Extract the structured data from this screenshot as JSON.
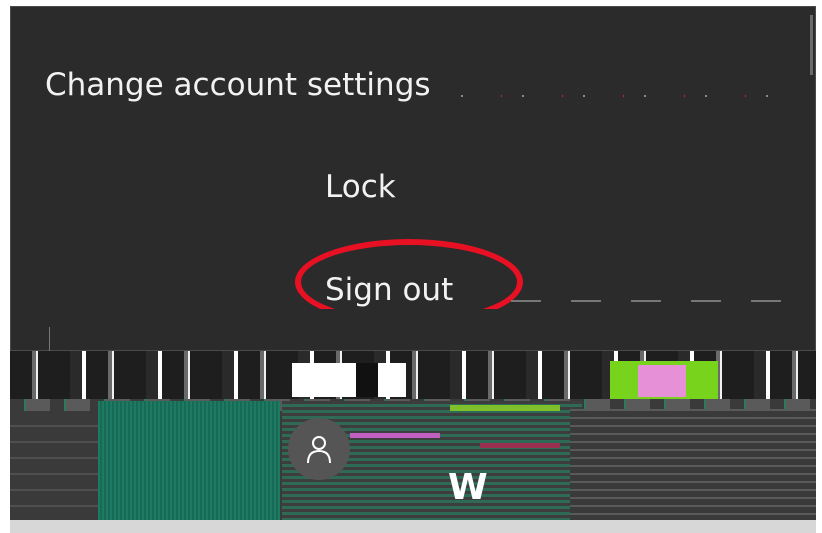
{
  "menu": {
    "items": [
      {
        "label": "Change account settings"
      },
      {
        "label": "Lock"
      },
      {
        "label": "Sign out"
      }
    ]
  },
  "user": {
    "initial": "W"
  },
  "colors": {
    "menu_background": "#2b2b2b",
    "menu_text": "#f2f2f2",
    "highlight": "#e81123",
    "avatar_background": "#555555"
  },
  "icons": {
    "avatar": "person-icon"
  }
}
